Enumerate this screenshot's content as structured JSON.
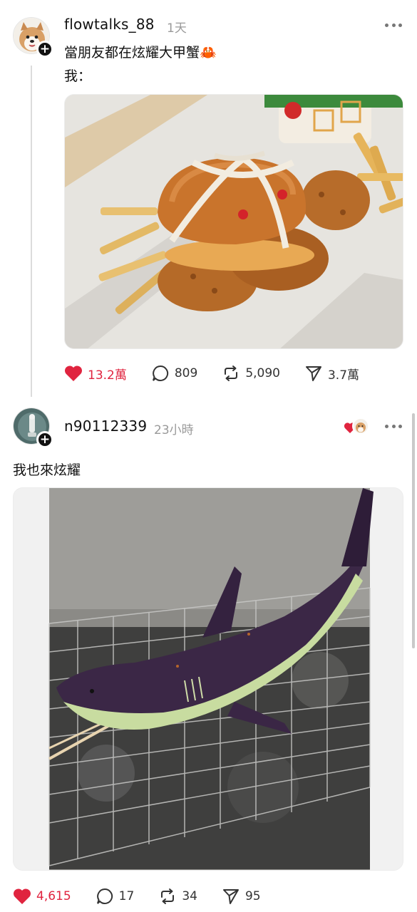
{
  "posts": [
    {
      "username": "flowtalks_88",
      "time": "1天",
      "text_line1": "當朋友都在炫耀大甲蟹🦀",
      "text_line2": "我：",
      "image_icon": "crab-burger-photo",
      "likes": "13.2萬",
      "comments": "809",
      "reposts": "5,090",
      "shares": "3.7萬"
    },
    {
      "username": "n90112339",
      "time": "23小時",
      "text": "我也來炫耀",
      "image_icon": "grilled-eggplant-shark-photo",
      "likes": "4,615",
      "comments": "17",
      "reposts": "34",
      "shares": "95"
    }
  ],
  "colors": {
    "like": "#e0243f",
    "text": "#111111",
    "muted": "#9a9a9a"
  }
}
